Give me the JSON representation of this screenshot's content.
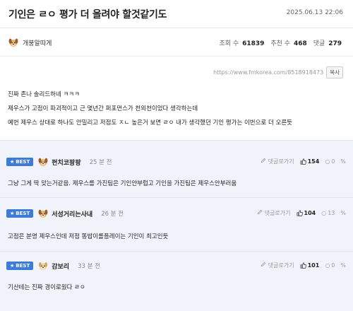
{
  "post": {
    "title": "기인은 ㄹㅇ 평가 더 올려야 할것같기도",
    "date": "2025.06.13 22:06",
    "author": "개붕알따게",
    "stats": {
      "views_label": "조회 수",
      "views": "61839",
      "recommend_label": "추천 수",
      "recommend": "468",
      "comments_label": "댓글",
      "comments": "279"
    },
    "url": "https://www.fmkorea.com/8518918473",
    "copy_label": "복사",
    "body": [
      "진짜 존나 솔리드하네 ㅋㅋㅋ",
      "제우스가 고점이 파괴적이고 근 몇년간 퍼포먼스가 천외천이었다 생각하는데",
      "예번 제우스 상대로 하나도 안밀리고 저점도 ㅈㄴ 높은거 보면 ㄹㅇ 내가 생각했던 기인 평가는 이번으로 더 오른듯"
    ]
  },
  "comments": [
    {
      "badge": "BEST",
      "name": "펀치코팡팡",
      "time": "25 분 전",
      "reply_label": "댓글로가기",
      "up": "154",
      "down": "0",
      "text": "그냥 그게 딱 맞는거같음. 제우스를 가진팀은 기인안부럽고 기인을 가진팀은 제우스안부러움"
    },
    {
      "badge": "BEST",
      "name": "서성거리는사내",
      "time": "26 분 전",
      "reply_label": "댓글로가기",
      "up": "104",
      "down": "13",
      "text": "고점은 분명 제우스인데 저점 똥밥이롤플레이는 기인이 최고인듯"
    },
    {
      "badge": "BEST",
      "name": "감보리",
      "time": "33 분 전",
      "reply_label": "댓글로가기",
      "up": "101",
      "down": "0",
      "text": "기산테는 진짜 경이로웠다 ㄹㅇ"
    }
  ],
  "colors": {
    "best_badge": "#3d7bd9",
    "comment_bg": "#f0f3fa"
  },
  "icons": {
    "author_avatar": "dog-face-icon",
    "comment_avatar": "dog-face-icon",
    "upvote": "thumbs-up-icon",
    "downvote": "circle-icon",
    "reply": "pencil-icon",
    "extra": "percent-icon"
  }
}
